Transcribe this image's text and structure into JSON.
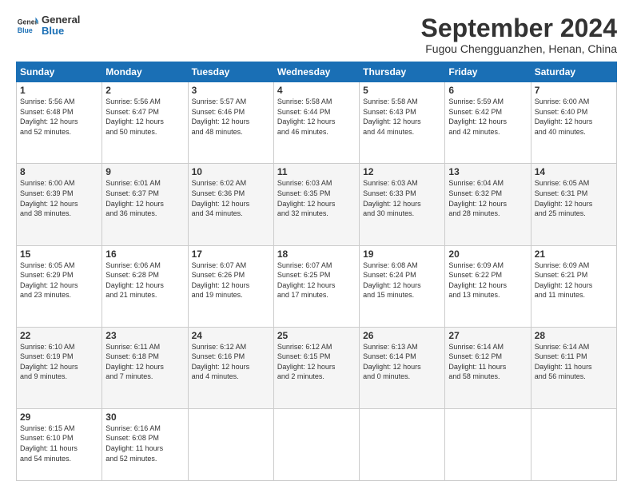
{
  "header": {
    "logo_line1": "General",
    "logo_line2": "Blue",
    "month_title": "September 2024",
    "location": "Fugou Chengguanzhen, Henan, China"
  },
  "days_of_week": [
    "Sunday",
    "Monday",
    "Tuesday",
    "Wednesday",
    "Thursday",
    "Friday",
    "Saturday"
  ],
  "weeks": [
    [
      {
        "day": "1",
        "lines": [
          "Sunrise: 5:56 AM",
          "Sunset: 6:48 PM",
          "Daylight: 12 hours",
          "and 52 minutes."
        ]
      },
      {
        "day": "2",
        "lines": [
          "Sunrise: 5:56 AM",
          "Sunset: 6:47 PM",
          "Daylight: 12 hours",
          "and 50 minutes."
        ]
      },
      {
        "day": "3",
        "lines": [
          "Sunrise: 5:57 AM",
          "Sunset: 6:46 PM",
          "Daylight: 12 hours",
          "and 48 minutes."
        ]
      },
      {
        "day": "4",
        "lines": [
          "Sunrise: 5:58 AM",
          "Sunset: 6:44 PM",
          "Daylight: 12 hours",
          "and 46 minutes."
        ]
      },
      {
        "day": "5",
        "lines": [
          "Sunrise: 5:58 AM",
          "Sunset: 6:43 PM",
          "Daylight: 12 hours",
          "and 44 minutes."
        ]
      },
      {
        "day": "6",
        "lines": [
          "Sunrise: 5:59 AM",
          "Sunset: 6:42 PM",
          "Daylight: 12 hours",
          "and 42 minutes."
        ]
      },
      {
        "day": "7",
        "lines": [
          "Sunrise: 6:00 AM",
          "Sunset: 6:40 PM",
          "Daylight: 12 hours",
          "and 40 minutes."
        ]
      }
    ],
    [
      {
        "day": "8",
        "lines": [
          "Sunrise: 6:00 AM",
          "Sunset: 6:39 PM",
          "Daylight: 12 hours",
          "and 38 minutes."
        ]
      },
      {
        "day": "9",
        "lines": [
          "Sunrise: 6:01 AM",
          "Sunset: 6:37 PM",
          "Daylight: 12 hours",
          "and 36 minutes."
        ]
      },
      {
        "day": "10",
        "lines": [
          "Sunrise: 6:02 AM",
          "Sunset: 6:36 PM",
          "Daylight: 12 hours",
          "and 34 minutes."
        ]
      },
      {
        "day": "11",
        "lines": [
          "Sunrise: 6:03 AM",
          "Sunset: 6:35 PM",
          "Daylight: 12 hours",
          "and 32 minutes."
        ]
      },
      {
        "day": "12",
        "lines": [
          "Sunrise: 6:03 AM",
          "Sunset: 6:33 PM",
          "Daylight: 12 hours",
          "and 30 minutes."
        ]
      },
      {
        "day": "13",
        "lines": [
          "Sunrise: 6:04 AM",
          "Sunset: 6:32 PM",
          "Daylight: 12 hours",
          "and 28 minutes."
        ]
      },
      {
        "day": "14",
        "lines": [
          "Sunrise: 6:05 AM",
          "Sunset: 6:31 PM",
          "Daylight: 12 hours",
          "and 25 minutes."
        ]
      }
    ],
    [
      {
        "day": "15",
        "lines": [
          "Sunrise: 6:05 AM",
          "Sunset: 6:29 PM",
          "Daylight: 12 hours",
          "and 23 minutes."
        ]
      },
      {
        "day": "16",
        "lines": [
          "Sunrise: 6:06 AM",
          "Sunset: 6:28 PM",
          "Daylight: 12 hours",
          "and 21 minutes."
        ]
      },
      {
        "day": "17",
        "lines": [
          "Sunrise: 6:07 AM",
          "Sunset: 6:26 PM",
          "Daylight: 12 hours",
          "and 19 minutes."
        ]
      },
      {
        "day": "18",
        "lines": [
          "Sunrise: 6:07 AM",
          "Sunset: 6:25 PM",
          "Daylight: 12 hours",
          "and 17 minutes."
        ]
      },
      {
        "day": "19",
        "lines": [
          "Sunrise: 6:08 AM",
          "Sunset: 6:24 PM",
          "Daylight: 12 hours",
          "and 15 minutes."
        ]
      },
      {
        "day": "20",
        "lines": [
          "Sunrise: 6:09 AM",
          "Sunset: 6:22 PM",
          "Daylight: 12 hours",
          "and 13 minutes."
        ]
      },
      {
        "day": "21",
        "lines": [
          "Sunrise: 6:09 AM",
          "Sunset: 6:21 PM",
          "Daylight: 12 hours",
          "and 11 minutes."
        ]
      }
    ],
    [
      {
        "day": "22",
        "lines": [
          "Sunrise: 6:10 AM",
          "Sunset: 6:19 PM",
          "Daylight: 12 hours",
          "and 9 minutes."
        ]
      },
      {
        "day": "23",
        "lines": [
          "Sunrise: 6:11 AM",
          "Sunset: 6:18 PM",
          "Daylight: 12 hours",
          "and 7 minutes."
        ]
      },
      {
        "day": "24",
        "lines": [
          "Sunrise: 6:12 AM",
          "Sunset: 6:16 PM",
          "Daylight: 12 hours",
          "and 4 minutes."
        ]
      },
      {
        "day": "25",
        "lines": [
          "Sunrise: 6:12 AM",
          "Sunset: 6:15 PM",
          "Daylight: 12 hours",
          "and 2 minutes."
        ]
      },
      {
        "day": "26",
        "lines": [
          "Sunrise: 6:13 AM",
          "Sunset: 6:14 PM",
          "Daylight: 12 hours",
          "and 0 minutes."
        ]
      },
      {
        "day": "27",
        "lines": [
          "Sunrise: 6:14 AM",
          "Sunset: 6:12 PM",
          "Daylight: 11 hours",
          "and 58 minutes."
        ]
      },
      {
        "day": "28",
        "lines": [
          "Sunrise: 6:14 AM",
          "Sunset: 6:11 PM",
          "Daylight: 11 hours",
          "and 56 minutes."
        ]
      }
    ],
    [
      {
        "day": "29",
        "lines": [
          "Sunrise: 6:15 AM",
          "Sunset: 6:10 PM",
          "Daylight: 11 hours",
          "and 54 minutes."
        ]
      },
      {
        "day": "30",
        "lines": [
          "Sunrise: 6:16 AM",
          "Sunset: 6:08 PM",
          "Daylight: 11 hours",
          "and 52 minutes."
        ]
      },
      {
        "day": "",
        "lines": []
      },
      {
        "day": "",
        "lines": []
      },
      {
        "day": "",
        "lines": []
      },
      {
        "day": "",
        "lines": []
      },
      {
        "day": "",
        "lines": []
      }
    ]
  ]
}
